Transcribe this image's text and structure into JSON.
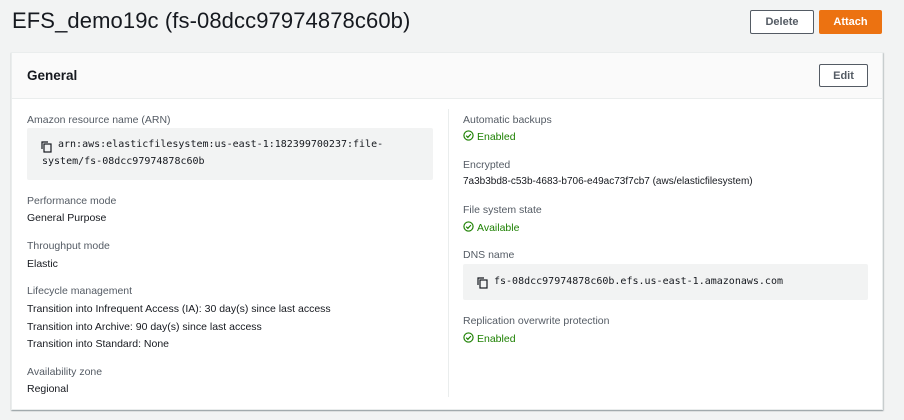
{
  "header": {
    "title": "EFS_demo19c (fs-08dcc97974878c60b)",
    "delete_label": "Delete",
    "attach_label": "Attach"
  },
  "general": {
    "title": "General",
    "edit_label": "Edit",
    "left": {
      "arn_label": "Amazon resource name (ARN)",
      "arn_line1": "arn:aws:elasticfilesystem:us-east-1:182399700237:file-",
      "arn_line2": "system/fs-08dcc97974878c60b",
      "performance_label": "Performance mode",
      "performance_value": "General Purpose",
      "throughput_label": "Throughput mode",
      "throughput_value": "Elastic",
      "lifecycle_label": "Lifecycle management",
      "lifecycle_lines": [
        "Transition into Infrequent Access (IA): 30 day(s) since last access",
        "Transition into Archive: 90 day(s) since last access",
        "Transition into Standard: None"
      ],
      "az_label": "Availability zone",
      "az_value": "Regional"
    },
    "right": {
      "backups_label": "Automatic backups",
      "backups_value": "Enabled",
      "encrypted_label": "Encrypted",
      "encrypted_value": "7a3b3bd8-c53b-4683-b706-e49ac73f7cb7 (aws/elasticfilesystem)",
      "state_label": "File system state",
      "state_value": "Available",
      "dns_label": "DNS name",
      "dns_value": "fs-08dcc97974878c60b.efs.us-east-1.amazonaws.com",
      "replication_label": "Replication overwrite protection",
      "replication_value": "Enabled"
    }
  },
  "colors": {
    "primary": "#ec7211",
    "success": "#1d8102",
    "label": "#545b64"
  },
  "icons": {
    "copy": "copy-icon",
    "status": "status-positive-icon"
  }
}
